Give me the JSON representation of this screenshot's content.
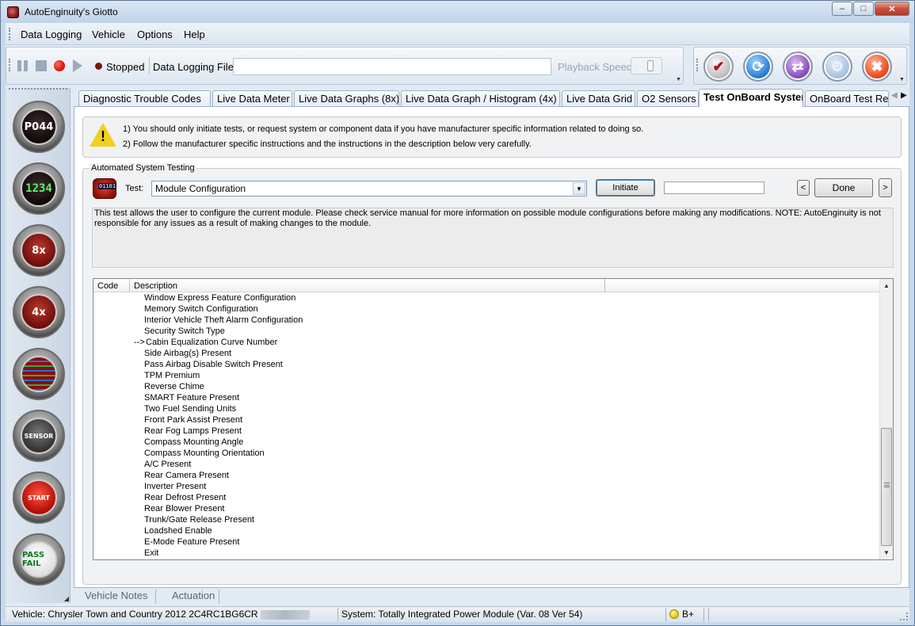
{
  "window": {
    "title": "AutoEnginuity's Giotto",
    "controls": [
      "–",
      "□",
      "✕"
    ]
  },
  "menu": [
    "Data Logging",
    "Vehicle",
    "Options",
    "Help"
  ],
  "toolbar": {
    "status": "Stopped",
    "file_label": "Data Logging File",
    "file_value": "",
    "playback_label": "Playback Speed",
    "right_buttons": [
      "check-clipboard-icon",
      "refresh-icon",
      "cycle-icon",
      "wrench-icon",
      "power-icon"
    ]
  },
  "sidebar": {
    "buttons": [
      {
        "name": "dtc-icon",
        "text": "P044"
      },
      {
        "name": "meter-icon",
        "text": "1234"
      },
      {
        "name": "graph-8x-icon",
        "text": "8x"
      },
      {
        "name": "graph-4x-icon",
        "text": "4x"
      },
      {
        "name": "grid-icon",
        "text": ""
      },
      {
        "name": "o2-sensor-icon",
        "text": "SENSOR"
      },
      {
        "name": "start-button-icon",
        "text": "START"
      },
      {
        "name": "pass-fail-icon",
        "text": "PASS FAIL"
      }
    ]
  },
  "tabs": [
    "Diagnostic Trouble Codes",
    "Live Data Meter",
    "Live Data Graphs (8x)",
    "Live Data Graph / Histogram (4x)",
    "Live Data Grid",
    "O2 Sensors",
    "Test OnBoard System",
    "OnBoard Test Re"
  ],
  "active_tab": "Test OnBoard System",
  "warning": {
    "line1": "1) You should only initiate tests, or request system or component data if you have manufacturer specific information related to doing so.",
    "line2": "2) Follow the manufacturer specific instructions and the instructions in the description below very carefully."
  },
  "automated": {
    "group_title": "Automated System Testing",
    "ecu_label": "01101",
    "test_label": "Test:",
    "test_value": "Module Configuration",
    "initiate_label": "Initiate",
    "status_value": "",
    "prev_label": "<",
    "done_label": "Done",
    "next_label": ">",
    "description": "This test allows the user to configure the current module. Please check service manual for more information on possible module configurations before making any modifications. NOTE: AutoEnginuity is not responsible for any issues as a result of making changes to the module."
  },
  "table": {
    "headers": [
      "Code",
      "Description",
      ""
    ],
    "rows": [
      {
        "arrow": "",
        "desc": "Window Express Feature Configuration"
      },
      {
        "arrow": "",
        "desc": "Memory Switch Configuration"
      },
      {
        "arrow": "",
        "desc": "Interior Vehicle Theft Alarm Configuration"
      },
      {
        "arrow": "",
        "desc": "Security Switch Type"
      },
      {
        "arrow": "-->",
        "desc": "Cabin Equalization Curve Number"
      },
      {
        "arrow": "",
        "desc": "Side Airbag(s) Present"
      },
      {
        "arrow": "",
        "desc": "Pass Airbag Disable Switch Present"
      },
      {
        "arrow": "",
        "desc": "TPM Premium"
      },
      {
        "arrow": "",
        "desc": "Reverse Chime"
      },
      {
        "arrow": "",
        "desc": "SMART Feature Present"
      },
      {
        "arrow": "",
        "desc": "Two Fuel Sending Units"
      },
      {
        "arrow": "",
        "desc": "Front Park Assist Present"
      },
      {
        "arrow": "",
        "desc": "Rear Fog Lamps Present"
      },
      {
        "arrow": "",
        "desc": "Compass Mounting Angle"
      },
      {
        "arrow": "",
        "desc": "Compass Mounting Orientation"
      },
      {
        "arrow": "",
        "desc": "A/C Present"
      },
      {
        "arrow": "",
        "desc": "Rear Camera Present"
      },
      {
        "arrow": "",
        "desc": "Inverter Present"
      },
      {
        "arrow": "",
        "desc": "Rear Defrost Present"
      },
      {
        "arrow": "",
        "desc": "Rear Blower Present"
      },
      {
        "arrow": "",
        "desc": "Trunk/Gate Release Present"
      },
      {
        "arrow": "",
        "desc": "Loadshed Enable"
      },
      {
        "arrow": "",
        "desc": "E-Mode Feature Present"
      },
      {
        "arrow": "",
        "desc": "Exit"
      }
    ]
  },
  "bottom_tabs": [
    "Vehicle Notes",
    "Actuation"
  ],
  "statusbar": {
    "vehicle": "Vehicle: Chrysler  Town and Country  2012  2C4RC1BG6CR",
    "system": "System: Totally Integrated Power Module (Var. 08 Ver 54)",
    "battery": "B+"
  }
}
